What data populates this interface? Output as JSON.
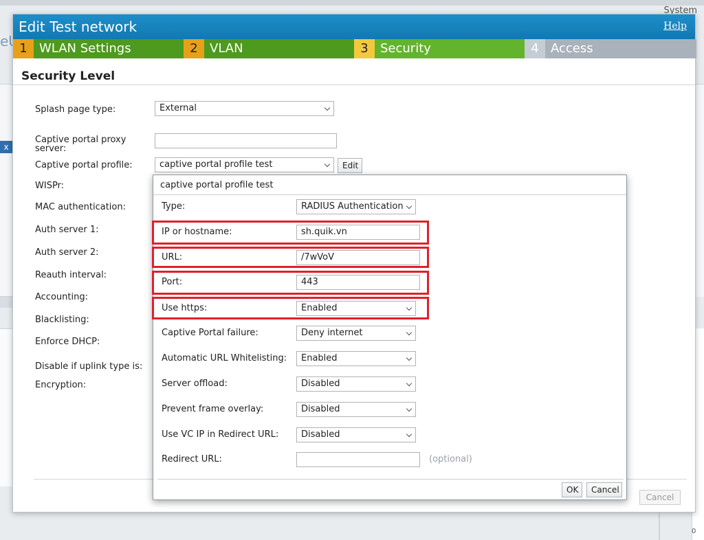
{
  "background": {
    "system_label": "System",
    "left_logo_fragment": "eU",
    "left_close": "x",
    "chart_zero": "0"
  },
  "dialog": {
    "title": "Edit Test network",
    "help": "Help",
    "steps": [
      {
        "num": "1",
        "label": "WLAN Settings"
      },
      {
        "num": "2",
        "label": "VLAN"
      },
      {
        "num": "3",
        "label": "Security"
      },
      {
        "num": "4",
        "label": "Access"
      }
    ],
    "section_title": "Security Level",
    "labels": {
      "splash_type": "Splash page type:",
      "proxy_server": "Captive portal proxy server:",
      "portal_profile": "Captive portal profile:",
      "wispr": "WISPr:",
      "mac_auth": "MAC authentication:",
      "auth1": "Auth server 1:",
      "auth2": "Auth server 2:",
      "reauth": "Reauth interval:",
      "accounting": "Accounting:",
      "blacklisting": "Blacklisting:",
      "enforce_dhcp": "Enforce DHCP:",
      "disable_uplink": "Disable if uplink type is:",
      "encryption": "Encryption:"
    },
    "values": {
      "splash_type": "External",
      "proxy_server": "",
      "portal_profile": "captive portal profile test"
    },
    "edit_button": "Edit",
    "bg_cancel": "Cancel"
  },
  "popup": {
    "title": "captive portal profile test",
    "rows": {
      "type": {
        "label": "Type:",
        "value": "RADIUS Authentication"
      },
      "ip": {
        "label": "IP or hostname:",
        "value": "sh.quik.vn"
      },
      "url": {
        "label": "URL:",
        "value": "/7wVoV"
      },
      "port": {
        "label": "Port:",
        "value": "443"
      },
      "https": {
        "label": "Use https:",
        "value": "Enabled"
      },
      "failure": {
        "label": "Captive Portal failure:",
        "value": "Deny internet"
      },
      "whitelist": {
        "label": "Automatic URL Whitelisting:",
        "value": "Enabled"
      },
      "offload": {
        "label": "Server offload:",
        "value": "Disabled"
      },
      "frame": {
        "label": "Prevent frame overlay:",
        "value": "Disabled"
      },
      "vcip": {
        "label": "Use VC IP in Redirect URL:",
        "value": "Disabled"
      },
      "redirect": {
        "label": "Redirect URL:",
        "value": ""
      }
    },
    "optional": "(optional)",
    "ok": "OK",
    "cancel": "Cancel"
  },
  "highlight_color": "#e0202a"
}
